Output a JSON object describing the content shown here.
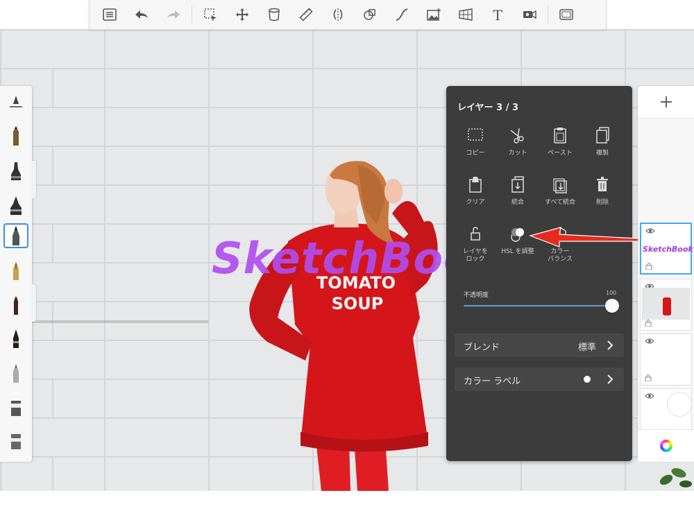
{
  "toolbar": {
    "items": [
      "list-icon",
      "undo-icon",
      "redo-icon",
      "select-icon",
      "move-icon",
      "bucket-icon",
      "ruler-icon",
      "symmetry-icon",
      "shape-icon",
      "curve-icon",
      "add-image-icon",
      "perspective-icon",
      "text-icon",
      "camera-icon",
      "fullscreen-icon"
    ]
  },
  "canvas": {
    "watermark": "SketchBook",
    "shirt_line1": "TOMATO",
    "shirt_line2": "SOUP"
  },
  "layer_panel": {
    "title": "レイヤー 3 / 3",
    "actions": [
      {
        "label": "コピー",
        "icon": "copy-icon"
      },
      {
        "label": "カット",
        "icon": "scissors-icon"
      },
      {
        "label": "ペースト",
        "icon": "paste-icon"
      },
      {
        "label": "複製",
        "icon": "duplicate-icon"
      },
      {
        "label": "クリア",
        "icon": "clear-icon"
      },
      {
        "label": "統合",
        "icon": "merge-icon"
      },
      {
        "label": "すべて統合",
        "icon": "merge-all-icon"
      },
      {
        "label": "削除",
        "icon": "trash-icon"
      },
      {
        "label": "レイヤを\nロック",
        "icon": "lock-icon"
      },
      {
        "label": "HSL を調整",
        "icon": "hsl-icon"
      },
      {
        "label": "カラー\nバランス",
        "icon": "color-balance-icon"
      }
    ],
    "opacity_label": "不透明度",
    "opacity_value": "100",
    "blend_label": "ブレンド",
    "blend_value": "標準",
    "color_label_label": "カラー ラベル"
  },
  "layers": {
    "thumb1_text": "SketchBook"
  },
  "colors": {
    "panel_bg": "#3c3c3c",
    "accent": "#3fa9f5",
    "watermark": "#b04ef0",
    "arrow": "#e82a1e",
    "sweater": "#d4161b"
  }
}
